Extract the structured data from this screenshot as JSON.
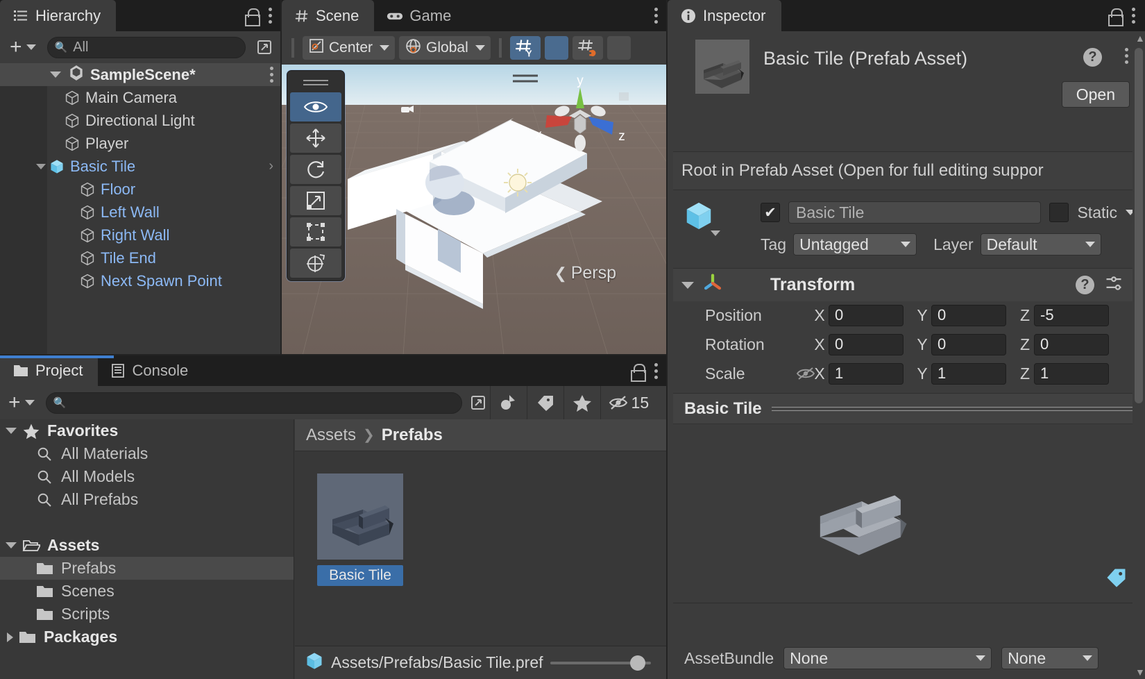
{
  "hierarchy": {
    "tab_label": "Hierarchy",
    "tab_icon": "hierarchy-list-icon",
    "search_placeholder": "All",
    "scene_root": "SampleScene*",
    "items": [
      {
        "label": "Main Camera",
        "color": "white",
        "indent": 2,
        "expandable": false
      },
      {
        "label": "Directional Light",
        "color": "white",
        "indent": 2,
        "expandable": false
      },
      {
        "label": "Player",
        "color": "white",
        "indent": 2,
        "expandable": false
      },
      {
        "label": "Basic Tile",
        "color": "blue",
        "indent": 1,
        "expandable": true,
        "prefab": true,
        "chevron": "›"
      },
      {
        "label": "Floor",
        "color": "blue",
        "indent": 3,
        "expandable": false
      },
      {
        "label": "Left Wall",
        "color": "blue",
        "indent": 3,
        "expandable": false
      },
      {
        "label": "Right Wall",
        "color": "blue",
        "indent": 3,
        "expandable": false
      },
      {
        "label": "Tile End",
        "color": "blue",
        "indent": 3,
        "expandable": false
      },
      {
        "label": "Next Spawn Point",
        "color": "blue",
        "indent": 3,
        "expandable": false
      }
    ]
  },
  "scene": {
    "tabs": [
      {
        "label": "Scene",
        "icon": "grid-hash-icon",
        "active": true
      },
      {
        "label": "Game",
        "icon": "gamepad-icon",
        "active": false
      }
    ],
    "pivot_mode": "Center",
    "handle_space": "Global",
    "grid_axis_label": "Y",
    "view_label": "Persp",
    "gizmo_axes": {
      "x": "x",
      "y": "y",
      "z": "z"
    },
    "tools": [
      {
        "name": "view-tool",
        "active": true
      },
      {
        "name": "move-tool",
        "active": false
      },
      {
        "name": "rotate-tool",
        "active": false
      },
      {
        "name": "scale-tool",
        "active": false
      },
      {
        "name": "rect-tool",
        "active": false
      },
      {
        "name": "transform-tool",
        "active": false
      }
    ]
  },
  "inspector": {
    "tab_label": "Inspector",
    "tab_icon": "info-icon",
    "asset_title": "Basic Tile (Prefab Asset)",
    "open_button": "Open",
    "prefab_note": "Root in Prefab Asset (Open for full editing suppor",
    "object_enabled": true,
    "object_name": "Basic Tile",
    "static_label": "Static",
    "static_checked": false,
    "tag_label": "Tag",
    "tag_value": "Untagged",
    "layer_label": "Layer",
    "layer_value": "Default",
    "transform": {
      "title": "Transform",
      "rows": [
        {
          "label": "Position",
          "x": "0",
          "y": "0",
          "z": "-5"
        },
        {
          "label": "Rotation",
          "x": "0",
          "y": "0",
          "z": "0"
        },
        {
          "label": "Scale",
          "x": "1",
          "y": "1",
          "z": "1"
        }
      ],
      "axis_x": "X",
      "axis_y": "Y",
      "axis_z": "Z"
    },
    "preview_title": "Basic Tile",
    "assetbundle_label": "AssetBundle",
    "assetbundle_value": "None",
    "assetbundle_variant": "None"
  },
  "project": {
    "tabs": [
      {
        "label": "Project",
        "icon": "folder-icon",
        "active": true
      },
      {
        "label": "Console",
        "icon": "console-icon",
        "active": false
      }
    ],
    "search_value": "",
    "visible_count": "15",
    "tree": [
      {
        "label": "Favorites",
        "indent": 0,
        "icon": "star-icon",
        "arrow": "down",
        "bold": true,
        "selected": false
      },
      {
        "label": "All Materials",
        "indent": 1,
        "icon": "search-icon",
        "arrow": "none",
        "bold": false,
        "selected": false
      },
      {
        "label": "All Models",
        "indent": 1,
        "icon": "search-icon",
        "arrow": "none",
        "bold": false,
        "selected": false
      },
      {
        "label": "All Prefabs",
        "indent": 1,
        "icon": "search-icon",
        "arrow": "none",
        "bold": false,
        "selected": false
      },
      {
        "label": "",
        "indent": 0,
        "icon": "spacer",
        "arrow": "none",
        "bold": false,
        "selected": false
      },
      {
        "label": "Assets",
        "indent": 0,
        "icon": "folder-open-icon",
        "arrow": "down",
        "bold": true,
        "selected": false
      },
      {
        "label": "Prefabs",
        "indent": 1,
        "icon": "folder-icon",
        "arrow": "none",
        "bold": false,
        "selected": true
      },
      {
        "label": "Scenes",
        "indent": 1,
        "icon": "folder-icon",
        "arrow": "none",
        "bold": false,
        "selected": false
      },
      {
        "label": "Scripts",
        "indent": 1,
        "icon": "folder-icon",
        "arrow": "none",
        "bold": false,
        "selected": false
      },
      {
        "label": "Packages",
        "indent": 0,
        "icon": "folder-icon",
        "arrow": "right",
        "bold": true,
        "selected": false
      }
    ],
    "breadcrumb": {
      "root": "Assets",
      "sep": "❯",
      "current": "Prefabs"
    },
    "assets": [
      {
        "name": "Basic Tile",
        "selected": true
      }
    ],
    "status_path": "Assets/Prefabs/Basic Tile.pref"
  },
  "colors": {
    "accent_blue": "#3f7fd0",
    "selection_blue": "#3a6ea8",
    "prefab_blue": "#8cb9f5",
    "panel_bg": "#3c3c3c",
    "toolbar_active": "#4a6b8f",
    "axis_x": "#c8453c",
    "axis_y": "#77c043",
    "axis_z": "#3b6fd4"
  }
}
